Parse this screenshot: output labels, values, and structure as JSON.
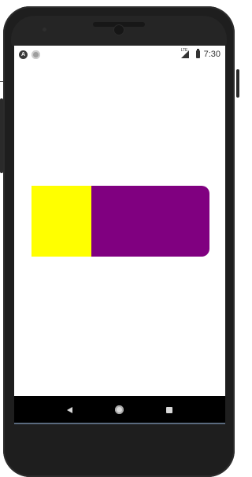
{
  "status_bar": {
    "app_icon_letter": "A",
    "network_label": "LTE",
    "time": "7:30"
  },
  "content": {
    "left_segment_color": "#ffff00",
    "right_segment_color": "#800080"
  },
  "navigation_bar": {
    "back_icon": "back-triangle",
    "home_icon": "home-circle",
    "recents_icon": "recents-square"
  },
  "device": {
    "frame_color": "#1e1e1e"
  }
}
